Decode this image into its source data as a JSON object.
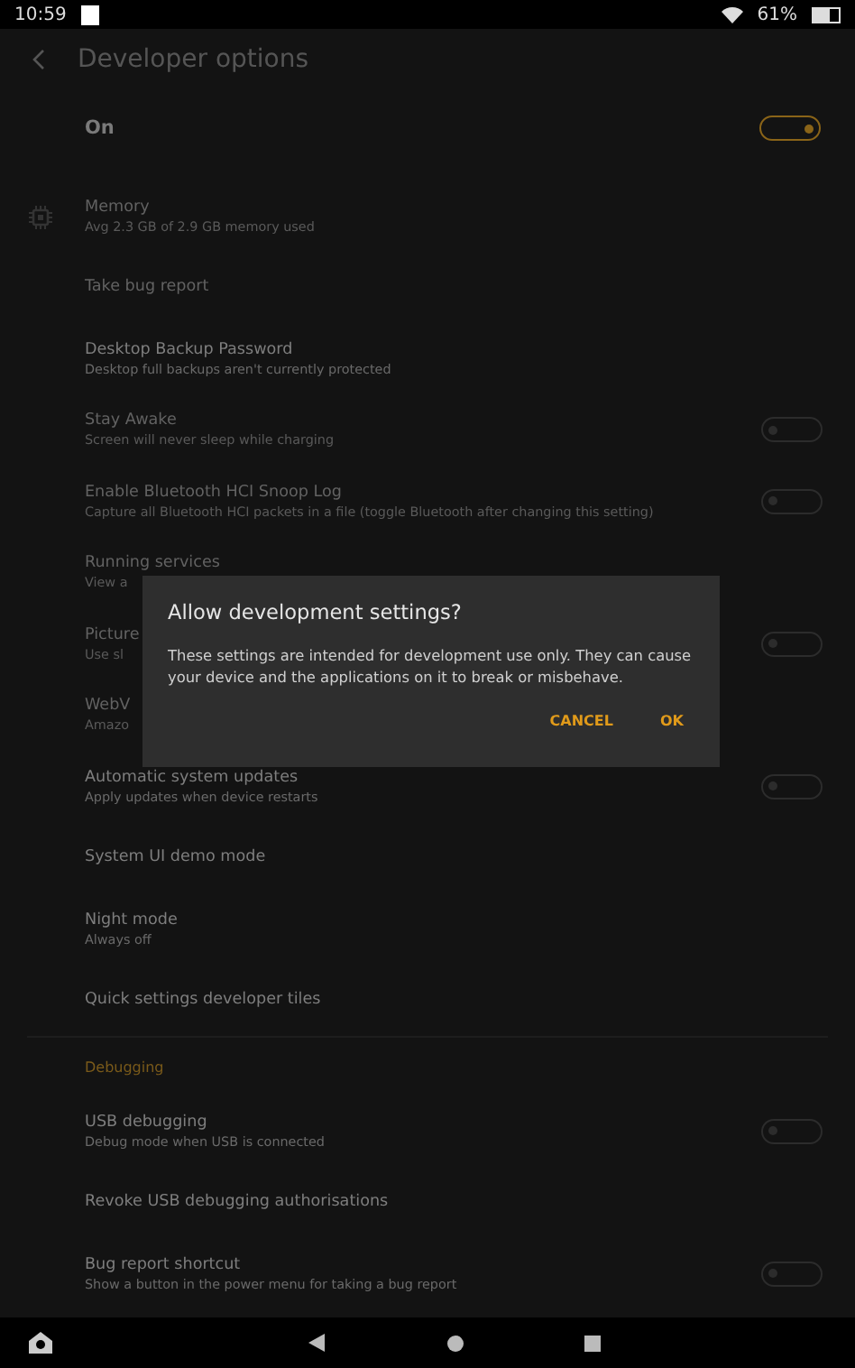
{
  "status_bar": {
    "time": "10:59",
    "battery": "61%"
  },
  "header": {
    "title": "Developer options"
  },
  "master": {
    "label": "On",
    "on": true
  },
  "items": [
    {
      "kind": "icon",
      "title": "Memory",
      "subtitle": "Avg 2.3 GB of 2.9 GB memory used",
      "disabled": true
    },
    {
      "kind": "plain",
      "title": "Take bug report",
      "disabled": true
    },
    {
      "kind": "plain",
      "title": "Desktop Backup Password",
      "subtitle": "Desktop full backups aren't currently protected",
      "disabled": false
    },
    {
      "kind": "toggle",
      "title": "Stay Awake",
      "subtitle": "Screen will never sleep while charging",
      "disabled": true,
      "on": false
    },
    {
      "kind": "toggle",
      "title": "Enable Bluetooth HCI Snoop Log",
      "subtitle": "Capture all Bluetooth HCI packets in a file (toggle Bluetooth after changing this setting)",
      "disabled": true,
      "on": false
    },
    {
      "kind": "plain",
      "title": "Running services",
      "subtitle": "View a",
      "disabled": true
    },
    {
      "kind": "toggle",
      "title": "Picture",
      "subtitle": "Use sl",
      "disabled": true,
      "on": false
    },
    {
      "kind": "plain",
      "title": "WebV",
      "subtitle": "Amazo",
      "disabled": true
    },
    {
      "kind": "toggle",
      "title": "Automatic system updates",
      "subtitle": "Apply updates when device restarts",
      "disabled": false,
      "on": false
    },
    {
      "kind": "plain",
      "title": "System UI demo mode",
      "disabled": false
    },
    {
      "kind": "plain",
      "title": "Night mode",
      "subtitle": "Always off",
      "disabled": false
    },
    {
      "kind": "plain",
      "title": "Quick settings developer tiles",
      "disabled": false
    },
    {
      "kind": "header",
      "title": "Debugging"
    },
    {
      "kind": "toggle",
      "title": "USB debugging",
      "subtitle": "Debug mode when USB is connected",
      "disabled": false,
      "on": false
    },
    {
      "kind": "plain",
      "title": "Revoke USB debugging authorisations",
      "disabled": false
    },
    {
      "kind": "toggle",
      "title": "Bug report shortcut",
      "subtitle": "Show a button in the power menu for taking a bug report",
      "disabled": false,
      "on": false
    }
  ],
  "dialog": {
    "title": "Allow development settings?",
    "message": "These settings are intended for development use only. They can cause your device and the applications on it to break or misbehave.",
    "buttons": [
      "CANCEL",
      "OK"
    ]
  }
}
